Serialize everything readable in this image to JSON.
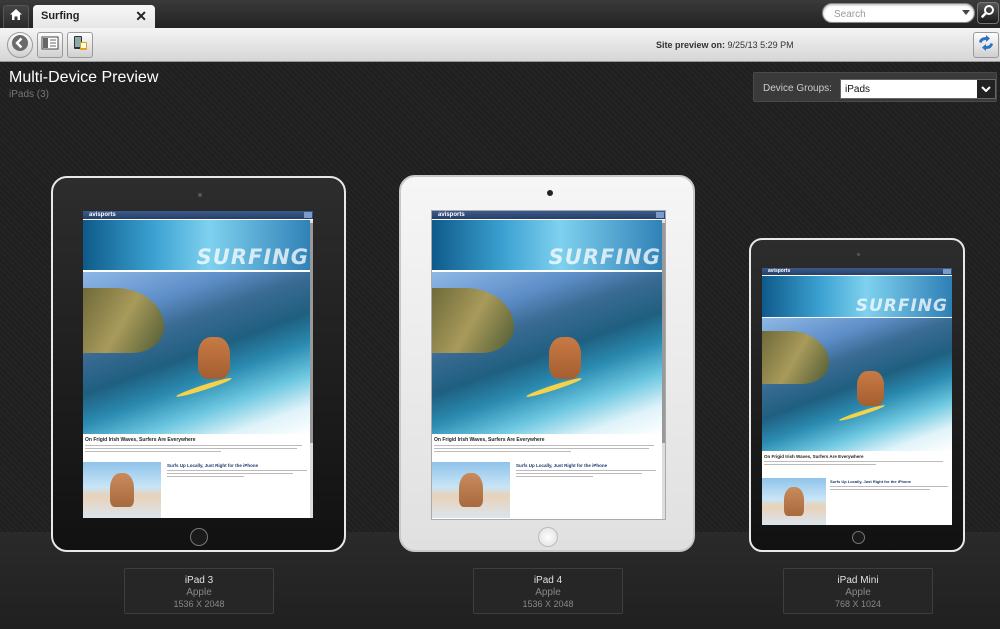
{
  "tabbar": {
    "home_icon": "home-icon",
    "tab": {
      "label": "Surfing",
      "close": "✕"
    },
    "search": {
      "placeholder": "Search",
      "go_icon": "search-icon"
    }
  },
  "toolbar": {
    "back_icon": "back-arrow-icon",
    "layout_icon": "layout-panel-icon",
    "device_icon": "device-preview-icon",
    "site_preview_label": "Site preview on:",
    "site_preview_value": "9/25/13 5:29 PM",
    "sync_icon": "sync-arrows-icon"
  },
  "main": {
    "title": "Multi-Device Preview",
    "subtitle": "iPads (3)",
    "device_groups": {
      "label": "Device Groups:",
      "selected": "iPads"
    }
  },
  "site": {
    "logo": "avisports",
    "banner": "SURFING",
    "article_title": "On Frigid Irish Waves, Surfers Are Everywhere",
    "side_title": "Surfs Up Locally, Just Right for the iPhone"
  },
  "devices": [
    {
      "name": "iPad 3",
      "maker": "Apple",
      "resolution": "1536 X 2048",
      "style": "dark"
    },
    {
      "name": "iPad 4",
      "maker": "Apple",
      "resolution": "1536 X 2048",
      "style": "light"
    },
    {
      "name": "iPad Mini",
      "maker": "Apple",
      "resolution": "768 X 1024",
      "style": "dark"
    }
  ],
  "colors": {
    "accent": "#2f6fc4",
    "background": "#1b1b1b",
    "site_header": "#2c4a78"
  }
}
